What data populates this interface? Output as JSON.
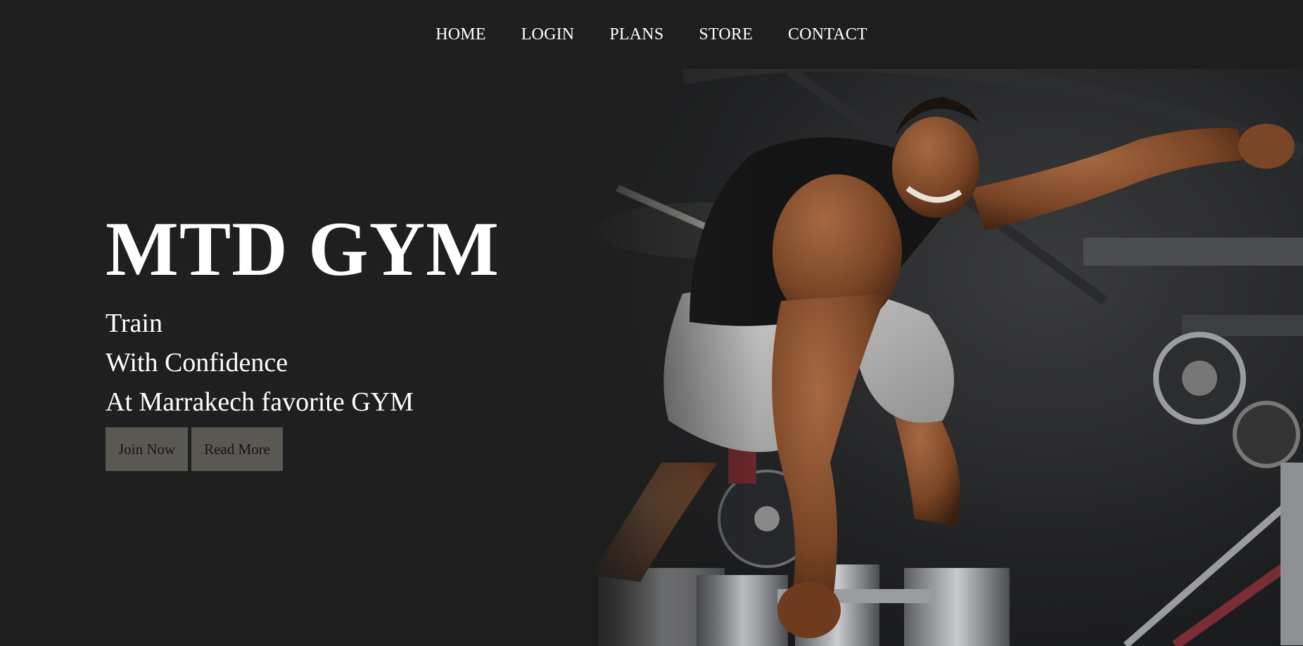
{
  "nav": {
    "items": [
      {
        "label": "HOME"
      },
      {
        "label": "LOGIN"
      },
      {
        "label": "PLANS"
      },
      {
        "label": "STORE"
      },
      {
        "label": "CONTACT"
      }
    ]
  },
  "hero": {
    "title": "MTD GYM",
    "tagline": [
      "Train",
      "With Confidence",
      "At Marrakech favorite GYM"
    ],
    "buttons": {
      "join": "Join Now",
      "read_more": "Read More"
    },
    "image_icon": "bodybuilder-deadlift-photo"
  },
  "colors": {
    "background": "#1f1f1f",
    "navbar": "#1e1e1e",
    "text": "#ffffff",
    "button_bg": "#5a5853",
    "button_text": "#141414"
  }
}
